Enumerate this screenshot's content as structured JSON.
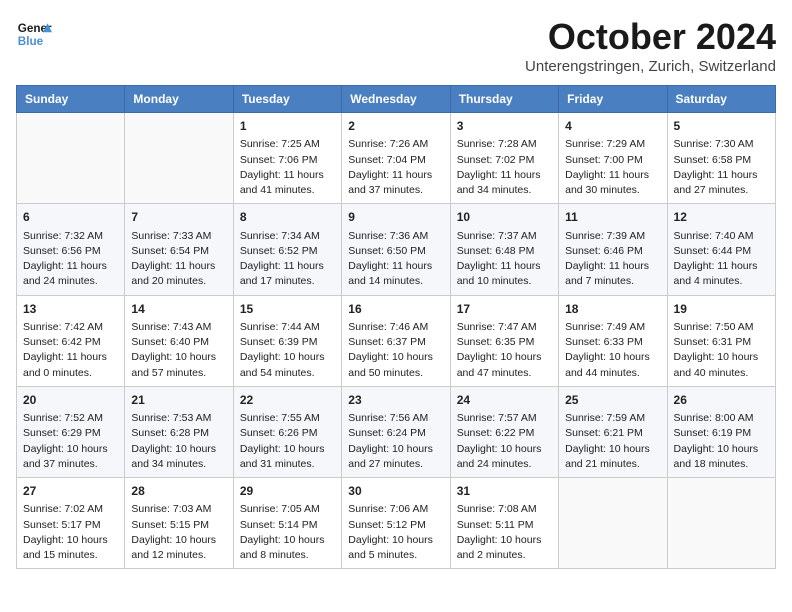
{
  "header": {
    "logo_line1": "General",
    "logo_line2": "Blue",
    "title": "October 2024",
    "location": "Unterengstringen, Zurich, Switzerland"
  },
  "days_of_week": [
    "Sunday",
    "Monday",
    "Tuesday",
    "Wednesday",
    "Thursday",
    "Friday",
    "Saturday"
  ],
  "weeks": [
    [
      {
        "day": null
      },
      {
        "day": null
      },
      {
        "day": "1",
        "sunrise": "Sunrise: 7:25 AM",
        "sunset": "Sunset: 7:06 PM",
        "daylight": "Daylight: 11 hours and 41 minutes."
      },
      {
        "day": "2",
        "sunrise": "Sunrise: 7:26 AM",
        "sunset": "Sunset: 7:04 PM",
        "daylight": "Daylight: 11 hours and 37 minutes."
      },
      {
        "day": "3",
        "sunrise": "Sunrise: 7:28 AM",
        "sunset": "Sunset: 7:02 PM",
        "daylight": "Daylight: 11 hours and 34 minutes."
      },
      {
        "day": "4",
        "sunrise": "Sunrise: 7:29 AM",
        "sunset": "Sunset: 7:00 PM",
        "daylight": "Daylight: 11 hours and 30 minutes."
      },
      {
        "day": "5",
        "sunrise": "Sunrise: 7:30 AM",
        "sunset": "Sunset: 6:58 PM",
        "daylight": "Daylight: 11 hours and 27 minutes."
      }
    ],
    [
      {
        "day": "6",
        "sunrise": "Sunrise: 7:32 AM",
        "sunset": "Sunset: 6:56 PM",
        "daylight": "Daylight: 11 hours and 24 minutes."
      },
      {
        "day": "7",
        "sunrise": "Sunrise: 7:33 AM",
        "sunset": "Sunset: 6:54 PM",
        "daylight": "Daylight: 11 hours and 20 minutes."
      },
      {
        "day": "8",
        "sunrise": "Sunrise: 7:34 AM",
        "sunset": "Sunset: 6:52 PM",
        "daylight": "Daylight: 11 hours and 17 minutes."
      },
      {
        "day": "9",
        "sunrise": "Sunrise: 7:36 AM",
        "sunset": "Sunset: 6:50 PM",
        "daylight": "Daylight: 11 hours and 14 minutes."
      },
      {
        "day": "10",
        "sunrise": "Sunrise: 7:37 AM",
        "sunset": "Sunset: 6:48 PM",
        "daylight": "Daylight: 11 hours and 10 minutes."
      },
      {
        "day": "11",
        "sunrise": "Sunrise: 7:39 AM",
        "sunset": "Sunset: 6:46 PM",
        "daylight": "Daylight: 11 hours and 7 minutes."
      },
      {
        "day": "12",
        "sunrise": "Sunrise: 7:40 AM",
        "sunset": "Sunset: 6:44 PM",
        "daylight": "Daylight: 11 hours and 4 minutes."
      }
    ],
    [
      {
        "day": "13",
        "sunrise": "Sunrise: 7:42 AM",
        "sunset": "Sunset: 6:42 PM",
        "daylight": "Daylight: 11 hours and 0 minutes."
      },
      {
        "day": "14",
        "sunrise": "Sunrise: 7:43 AM",
        "sunset": "Sunset: 6:40 PM",
        "daylight": "Daylight: 10 hours and 57 minutes."
      },
      {
        "day": "15",
        "sunrise": "Sunrise: 7:44 AM",
        "sunset": "Sunset: 6:39 PM",
        "daylight": "Daylight: 10 hours and 54 minutes."
      },
      {
        "day": "16",
        "sunrise": "Sunrise: 7:46 AM",
        "sunset": "Sunset: 6:37 PM",
        "daylight": "Daylight: 10 hours and 50 minutes."
      },
      {
        "day": "17",
        "sunrise": "Sunrise: 7:47 AM",
        "sunset": "Sunset: 6:35 PM",
        "daylight": "Daylight: 10 hours and 47 minutes."
      },
      {
        "day": "18",
        "sunrise": "Sunrise: 7:49 AM",
        "sunset": "Sunset: 6:33 PM",
        "daylight": "Daylight: 10 hours and 44 minutes."
      },
      {
        "day": "19",
        "sunrise": "Sunrise: 7:50 AM",
        "sunset": "Sunset: 6:31 PM",
        "daylight": "Daylight: 10 hours and 40 minutes."
      }
    ],
    [
      {
        "day": "20",
        "sunrise": "Sunrise: 7:52 AM",
        "sunset": "Sunset: 6:29 PM",
        "daylight": "Daylight: 10 hours and 37 minutes."
      },
      {
        "day": "21",
        "sunrise": "Sunrise: 7:53 AM",
        "sunset": "Sunset: 6:28 PM",
        "daylight": "Daylight: 10 hours and 34 minutes."
      },
      {
        "day": "22",
        "sunrise": "Sunrise: 7:55 AM",
        "sunset": "Sunset: 6:26 PM",
        "daylight": "Daylight: 10 hours and 31 minutes."
      },
      {
        "day": "23",
        "sunrise": "Sunrise: 7:56 AM",
        "sunset": "Sunset: 6:24 PM",
        "daylight": "Daylight: 10 hours and 27 minutes."
      },
      {
        "day": "24",
        "sunrise": "Sunrise: 7:57 AM",
        "sunset": "Sunset: 6:22 PM",
        "daylight": "Daylight: 10 hours and 24 minutes."
      },
      {
        "day": "25",
        "sunrise": "Sunrise: 7:59 AM",
        "sunset": "Sunset: 6:21 PM",
        "daylight": "Daylight: 10 hours and 21 minutes."
      },
      {
        "day": "26",
        "sunrise": "Sunrise: 8:00 AM",
        "sunset": "Sunset: 6:19 PM",
        "daylight": "Daylight: 10 hours and 18 minutes."
      }
    ],
    [
      {
        "day": "27",
        "sunrise": "Sunrise: 7:02 AM",
        "sunset": "Sunset: 5:17 PM",
        "daylight": "Daylight: 10 hours and 15 minutes."
      },
      {
        "day": "28",
        "sunrise": "Sunrise: 7:03 AM",
        "sunset": "Sunset: 5:15 PM",
        "daylight": "Daylight: 10 hours and 12 minutes."
      },
      {
        "day": "29",
        "sunrise": "Sunrise: 7:05 AM",
        "sunset": "Sunset: 5:14 PM",
        "daylight": "Daylight: 10 hours and 8 minutes."
      },
      {
        "day": "30",
        "sunrise": "Sunrise: 7:06 AM",
        "sunset": "Sunset: 5:12 PM",
        "daylight": "Daylight: 10 hours and 5 minutes."
      },
      {
        "day": "31",
        "sunrise": "Sunrise: 7:08 AM",
        "sunset": "Sunset: 5:11 PM",
        "daylight": "Daylight: 10 hours and 2 minutes."
      },
      {
        "day": null
      },
      {
        "day": null
      }
    ]
  ]
}
